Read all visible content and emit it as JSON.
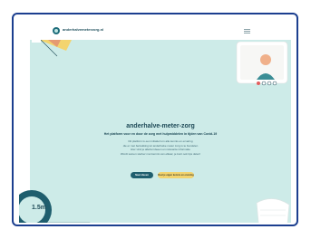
{
  "header": {
    "site_name": "anderhalvemeterzorg.nl",
    "menu_icon": "hamburger-menu-icon"
  },
  "hero": {
    "title": "anderhalve-meter-zorg",
    "subtitle": "Het platform voor en door de zorg met hulpmiddelen in tijden van Covid-19",
    "text_lines": [
      "Dit platform is een initiatief om alle kennis en ervaring",
      "die er met betrekking tot anderhalve meter zorg is te bundelen",
      "Hier vind je allerlei ideeen en relevante informatie",
      "Wordt samen sterker met kennis van elkaar, je kunt ook tips delen!"
    ],
    "primary_button": "Naar ideeen",
    "secondary_button": "Deel je eigen kennis en ervaring"
  },
  "decorations": {
    "tape_label": "1.5m"
  },
  "colors": {
    "frame_border": "#1c3f8f",
    "hero_background": "#cdebe8",
    "primary": "#1f5e6e",
    "accent": "#f3d46f"
  }
}
